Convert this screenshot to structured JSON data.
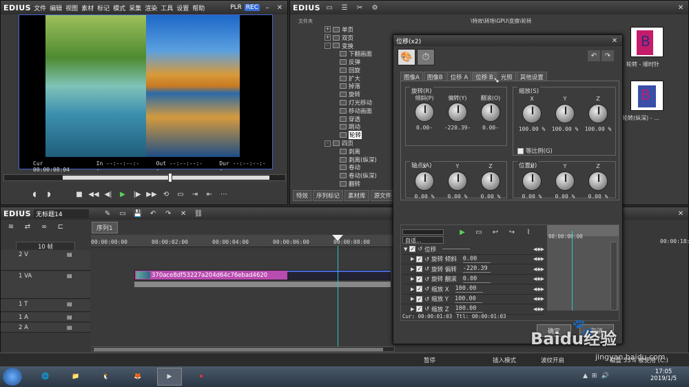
{
  "player": {
    "logo": "EDIUS",
    "menu": [
      "文件",
      "编辑",
      "视图",
      "素材",
      "标记",
      "模式",
      "采集",
      "渲染",
      "工具",
      "设置",
      "帮助"
    ],
    "plr": "PLR",
    "rec": "REC",
    "tc": {
      "cur_label": "Cur",
      "cur": "00:00:08:04",
      "in_label": "In",
      "in": "--:--:--:--",
      "out_label": "Out",
      "out": "--:--:--:--",
      "dur_label": "Dur",
      "dur": "--:--:--:--"
    }
  },
  "bin": {
    "logo": "EDIUS",
    "folder_header": "文件夹",
    "path": "\\特效\\转场\\GPU\\变换\\轮转",
    "tree": [
      {
        "label": "单页",
        "indent": 0,
        "expander": "+"
      },
      {
        "label": "双页",
        "indent": 0,
        "expander": "+"
      },
      {
        "label": "变换",
        "indent": 0,
        "expander": "-"
      },
      {
        "label": "下翻画面",
        "indent": 1
      },
      {
        "label": "反弹",
        "indent": 1
      },
      {
        "label": "回旋",
        "indent": 1
      },
      {
        "label": "扩大",
        "indent": 1
      },
      {
        "label": "掉落",
        "indent": 1
      },
      {
        "label": "旋转",
        "indent": 1
      },
      {
        "label": "灯光移动",
        "indent": 1
      },
      {
        "label": "移动画面",
        "indent": 1
      },
      {
        "label": "穿透",
        "indent": 1
      },
      {
        "label": "跳动",
        "indent": 1
      },
      {
        "label": "轮转",
        "indent": 1,
        "selected": true
      },
      {
        "label": "四页",
        "indent": 0,
        "expander": "-"
      },
      {
        "label": "剥离",
        "indent": 1
      },
      {
        "label": "剥离(纵深)",
        "indent": 1
      },
      {
        "label": "卷动",
        "indent": 1
      },
      {
        "label": "卷动(纵深)",
        "indent": 1
      },
      {
        "label": "翻转",
        "indent": 1
      }
    ],
    "tabs": [
      "特效",
      "序列标记",
      "素材库",
      "源文件"
    ],
    "thumbs": [
      {
        "label": "轮转 - 顺时针"
      },
      {
        "label": "轮转(纵深) - ..."
      }
    ]
  },
  "timeline": {
    "logo": "EDIUS",
    "project": "无标题14",
    "sequence_tab": "序列1",
    "scale": "10 帧",
    "ruler": [
      "00:00:00:00",
      "00:00:02:00",
      "00:00:04:00",
      "00:00:06:00",
      "00:00:08:00"
    ],
    "ruler_right": "00:00:18:00",
    "tracks": [
      {
        "name": "2 V"
      },
      {
        "name": "1 VA"
      },
      {
        "name": "1 T"
      },
      {
        "name": "1 A"
      },
      {
        "name": "2 A"
      }
    ],
    "clip_name": "370ace8df53227a204d64c76ebad4620"
  },
  "dialog": {
    "title": "位移(x2)",
    "tabs": [
      "图像A",
      "图像B",
      "位移 A",
      "位移 B",
      "光照",
      "其他设置"
    ],
    "rotation": {
      "title": "旋转(R)",
      "cols": [
        {
          "label": "倾斜(P)",
          "value": "0.00-"
        },
        {
          "label": "偏转(Y)",
          "value": "-220.39-"
        },
        {
          "label": "翻滚(O)",
          "value": "0.00-"
        }
      ]
    },
    "scale": {
      "title": "缩放(S)",
      "cols": [
        {
          "label": "X",
          "value": "100.00 %"
        },
        {
          "label": "Y",
          "value": "100.00 %"
        },
        {
          "label": "Z",
          "value": "100.00 %"
        }
      ],
      "proportional": "等比例(G)"
    },
    "axis": {
      "title": "轴点(A)",
      "cols": [
        {
          "label": "X",
          "value": "0.00 %"
        },
        {
          "label": "Y",
          "value": "0.00 %"
        },
        {
          "label": "Z",
          "value": "0.00 %"
        }
      ]
    },
    "position": {
      "title": "位置(I)",
      "cols": [
        {
          "label": "X",
          "value": "0.00 %"
        },
        {
          "label": "Y",
          "value": "0.00 %"
        },
        {
          "label": "Z",
          "value": "0.00 %"
        }
      ]
    },
    "kf_mode": "自适...",
    "kf_rows": [
      {
        "label": "位移",
        "value": "",
        "root": true
      },
      {
        "label": "旋转 倾斜",
        "value": "0.00"
      },
      {
        "label": "旋转 偏转",
        "value": "-220.39"
      },
      {
        "label": "旋转 翻滚",
        "value": "0.00"
      },
      {
        "label": "缩放 X",
        "value": "100.00"
      },
      {
        "label": "缩放 Y",
        "value": "100.00"
      },
      {
        "label": "缩放 Z",
        "value": "100.00"
      }
    ],
    "cur": "Cur: 00:00:01:03",
    "ttl": "Ttl: 00:00:01:03",
    "kf_ruler": "00:00:00:00",
    "ok": "确定",
    "cancel": "取消"
  },
  "status": {
    "pause": "暂停",
    "insert": "插入模式",
    "ripple": "波纹开启",
    "disk": "磁盘 53% 被使用 (C:)"
  },
  "taskbar": {
    "time": "17:05",
    "date": "2019/1/5"
  },
  "watermark": {
    "brand": "Baidu经验",
    "url": "jingyan.baidu.com"
  }
}
